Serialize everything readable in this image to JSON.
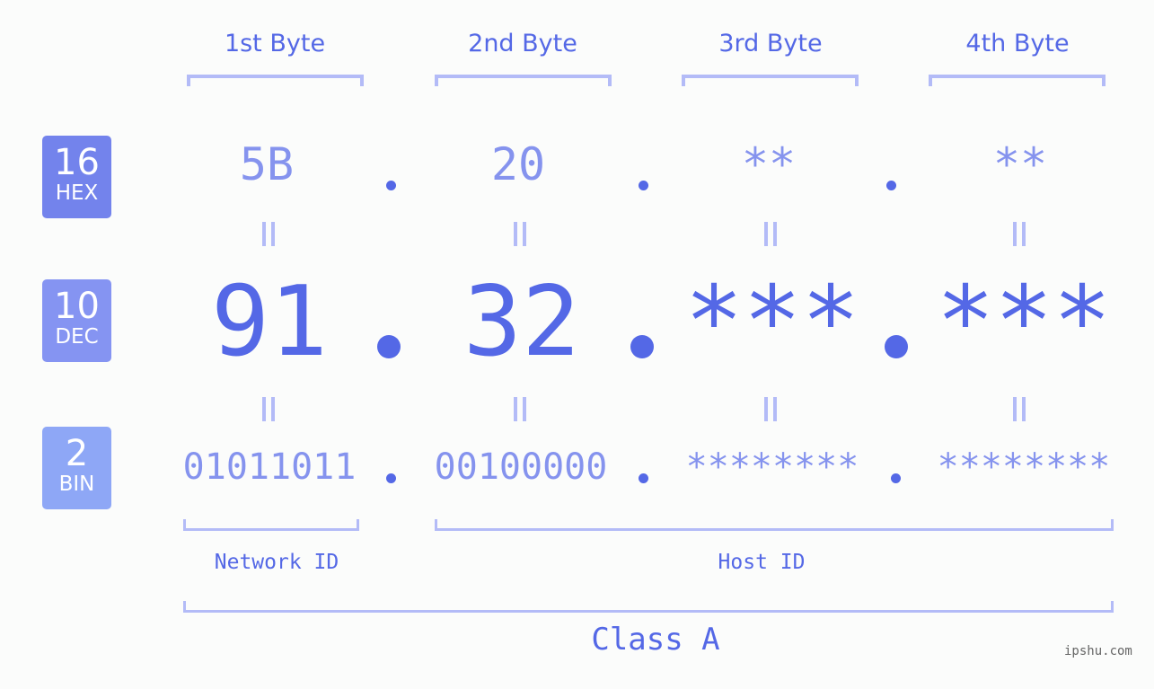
{
  "byte_headers": [
    "1st Byte",
    "2nd Byte",
    "3rd Byte",
    "4th Byte"
  ],
  "badges": {
    "hex": {
      "base": "16",
      "label": "HEX",
      "color": "#7383ec"
    },
    "dec": {
      "base": "10",
      "label": "DEC",
      "color": "#8594f2"
    },
    "bin": {
      "base": "2",
      "label": "BIN",
      "color": "#8ea7f6"
    }
  },
  "hex": [
    "5B",
    "20",
    "**",
    "**"
  ],
  "dec": [
    "91",
    "32",
    "***",
    "***"
  ],
  "bin": [
    "01011011",
    "00100000",
    "********",
    "********"
  ],
  "separator": ".",
  "segments": {
    "network": "Network ID",
    "host": "Host ID",
    "class": "Class A"
  },
  "watermark": "ipshu.com",
  "colors": {
    "accent": "#5468e6",
    "light_value": "#8593ee",
    "bracket": "#b3bbf7",
    "background": "#fbfcfb"
  }
}
